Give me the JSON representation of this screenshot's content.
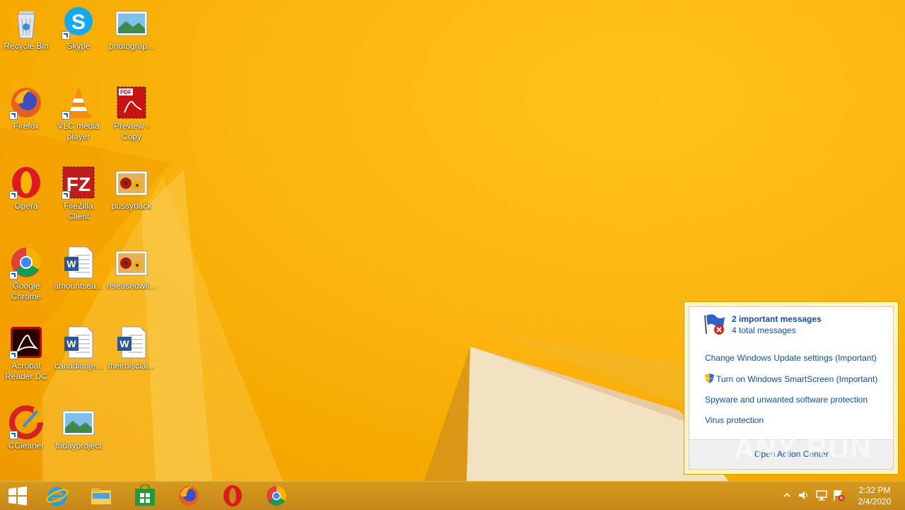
{
  "desktop_icons": [
    {
      "id": "recycle-bin",
      "label": "Recycle Bin"
    },
    {
      "id": "skype",
      "label": "Skype"
    },
    {
      "id": "photograp",
      "label": "photograp..."
    },
    {
      "id": "firefox",
      "label": "Firefox"
    },
    {
      "id": "vlc",
      "label": "VLC media player"
    },
    {
      "id": "preview-copy",
      "label": "Preview - Copy"
    },
    {
      "id": "opera",
      "label": "Opera"
    },
    {
      "id": "filezilla",
      "label": "FileZilla Client"
    },
    {
      "id": "pussyback",
      "label": "pussyback"
    },
    {
      "id": "chrome",
      "label": "Google Chrome"
    },
    {
      "id": "amountsea",
      "label": "amountsea..."
    },
    {
      "id": "releasedwit",
      "label": "releasedwit..."
    },
    {
      "id": "acrobat",
      "label": "Acrobat Reader DC"
    },
    {
      "id": "canadianje",
      "label": "canadianje..."
    },
    {
      "id": "theirdisclai",
      "label": "theirdisclai..."
    },
    {
      "id": "ccleaner",
      "label": "CCleaner"
    },
    {
      "id": "fridayproject",
      "label": "fridayproject"
    }
  ],
  "action_center": {
    "title": "2 important messages",
    "subtitle": "4 total messages",
    "items": [
      "Change Windows Update settings (Important)",
      "Turn on Windows SmartScreen (Important)",
      "Spyware and unwanted software protection",
      "Virus protection"
    ],
    "footer_link": "Open Action Center"
  },
  "watermark": "ANY RUN",
  "taskbar": {
    "pinned": [
      "start-button",
      "internet-explorer",
      "file-explorer",
      "store",
      "firefox",
      "opera",
      "chrome"
    ]
  },
  "clock": {
    "time": "2:32 PM",
    "date": "2/4/2020"
  },
  "colors": {
    "wallpaper": "#f7b500",
    "link": "#0d4fb5",
    "taskbar": "#c7871a"
  }
}
